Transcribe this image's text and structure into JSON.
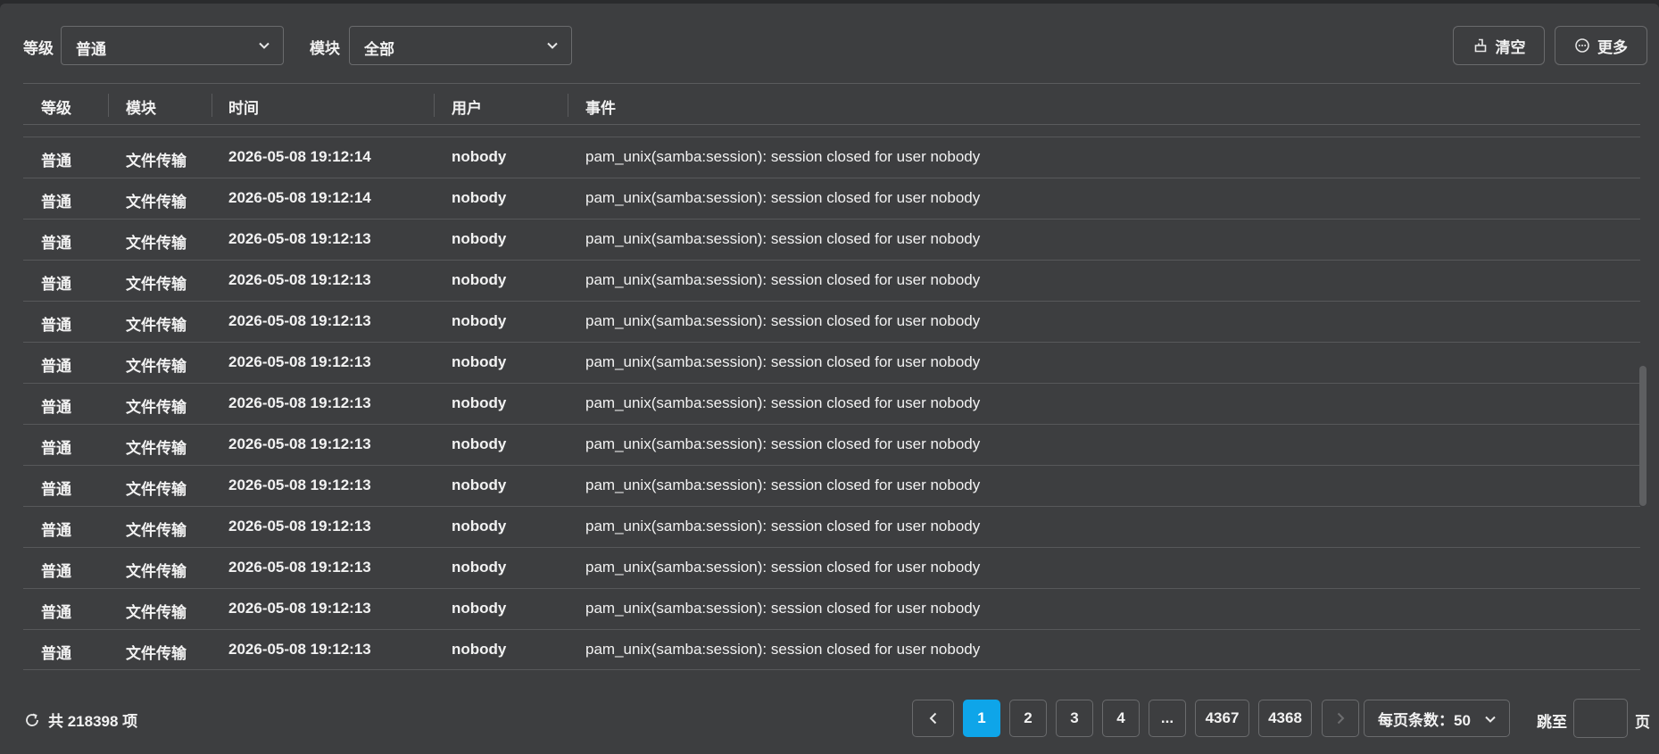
{
  "filters": {
    "level_label": "等级",
    "level_value": "普通",
    "module_label": "模块",
    "module_value": "全部"
  },
  "actions": {
    "clear_label": "清空",
    "more_label": "更多"
  },
  "table": {
    "columns": [
      "等级",
      "模块",
      "时间",
      "用户",
      "事件"
    ],
    "rows": [
      {
        "level": "普通",
        "module": "文件传输",
        "time": "2026-05-08 19:12:14",
        "user": "nobody",
        "event": "pam_unix(samba:session): session closed for user nobody"
      },
      {
        "level": "普通",
        "module": "文件传输",
        "time": "2026-05-08 19:12:14",
        "user": "nobody",
        "event": "pam_unix(samba:session): session closed for user nobody"
      },
      {
        "level": "普通",
        "module": "文件传输",
        "time": "2026-05-08 19:12:13",
        "user": "nobody",
        "event": "pam_unix(samba:session): session closed for user nobody"
      },
      {
        "level": "普通",
        "module": "文件传输",
        "time": "2026-05-08 19:12:13",
        "user": "nobody",
        "event": "pam_unix(samba:session): session closed for user nobody"
      },
      {
        "level": "普通",
        "module": "文件传输",
        "time": "2026-05-08 19:12:13",
        "user": "nobody",
        "event": "pam_unix(samba:session): session closed for user nobody"
      },
      {
        "level": "普通",
        "module": "文件传输",
        "time": "2026-05-08 19:12:13",
        "user": "nobody",
        "event": "pam_unix(samba:session): session closed for user nobody"
      },
      {
        "level": "普通",
        "module": "文件传输",
        "time": "2026-05-08 19:12:13",
        "user": "nobody",
        "event": "pam_unix(samba:session): session closed for user nobody"
      },
      {
        "level": "普通",
        "module": "文件传输",
        "time": "2026-05-08 19:12:13",
        "user": "nobody",
        "event": "pam_unix(samba:session): session closed for user nobody"
      },
      {
        "level": "普通",
        "module": "文件传输",
        "time": "2026-05-08 19:12:13",
        "user": "nobody",
        "event": "pam_unix(samba:session): session closed for user nobody"
      },
      {
        "level": "普通",
        "module": "文件传输",
        "time": "2026-05-08 19:12:13",
        "user": "nobody",
        "event": "pam_unix(samba:session): session closed for user nobody"
      },
      {
        "level": "普通",
        "module": "文件传输",
        "time": "2026-05-08 19:12:13",
        "user": "nobody",
        "event": "pam_unix(samba:session): session closed for user nobody"
      },
      {
        "level": "普通",
        "module": "文件传输",
        "time": "2026-05-08 19:12:13",
        "user": "nobody",
        "event": "pam_unix(samba:session): session closed for user nobody"
      },
      {
        "level": "普通",
        "module": "文件传输",
        "time": "2026-05-08 19:12:13",
        "user": "nobody",
        "event": "pam_unix(samba:session): session closed for user nobody"
      }
    ]
  },
  "footer": {
    "total_text": "共 218398 项",
    "pages": [
      "1",
      "2",
      "3",
      "4",
      "...",
      "4367",
      "4368"
    ],
    "current_page": "1",
    "page_size_label": "每页条数：50",
    "goto_label": "跳至",
    "goto_suffix": "页",
    "goto_value": ""
  },
  "colors": {
    "panel_bg": "#3d3e40",
    "accent": "#0ea5e9",
    "border": "#6a6b6d"
  },
  "icons": {
    "select_chevron": "chevron-down-icon",
    "clear": "broom-icon",
    "more": "more-circle-icon",
    "refresh": "refresh-icon",
    "prev": "chevron-left-icon",
    "next": "chevron-right-icon"
  }
}
